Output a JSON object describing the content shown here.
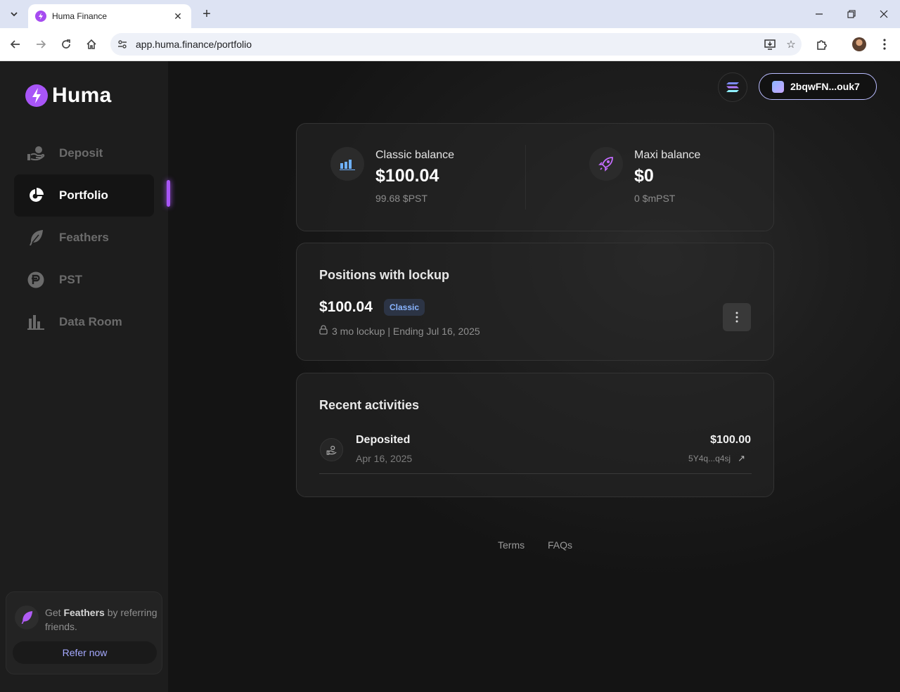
{
  "browser": {
    "tab_title": "Huma Finance",
    "url": "app.huma.finance/portfolio"
  },
  "brand": {
    "name": "Huma",
    "accent": "#a855f7"
  },
  "sidebar": {
    "items": [
      {
        "label": "Deposit",
        "icon": "hand-coin-icon"
      },
      {
        "label": "Portfolio",
        "icon": "pie-chart-icon",
        "active": true
      },
      {
        "label": "Feathers",
        "icon": "feather-icon"
      },
      {
        "label": "PST",
        "icon": "pst-token-icon"
      },
      {
        "label": "Data Room",
        "icon": "bar-chart-icon"
      }
    ],
    "promo": {
      "text_prefix": "Get ",
      "text_highlight": "Feathers",
      "text_suffix": " by referring friends.",
      "button": "Refer now"
    }
  },
  "header": {
    "wallet_address": "2bqwFN...ouk7"
  },
  "balances": {
    "classic": {
      "title": "Classic balance",
      "amount": "$100.04",
      "sub": "99.68 $PST"
    },
    "maxi": {
      "title": "Maxi balance",
      "amount": "$0",
      "sub": "0 $mPST"
    }
  },
  "positions": {
    "title": "Positions with lockup",
    "amount": "$100.04",
    "badge": "Classic",
    "lock_text": "3 mo lockup | Ending Jul 16, 2025"
  },
  "activities": {
    "title": "Recent activities",
    "items": [
      {
        "type": "Deposited",
        "date": "Apr 16, 2025",
        "amount": "$100.00",
        "tx": "5Y4q...q4sj"
      }
    ]
  },
  "footer": {
    "terms": "Terms",
    "faqs": "FAQs"
  }
}
